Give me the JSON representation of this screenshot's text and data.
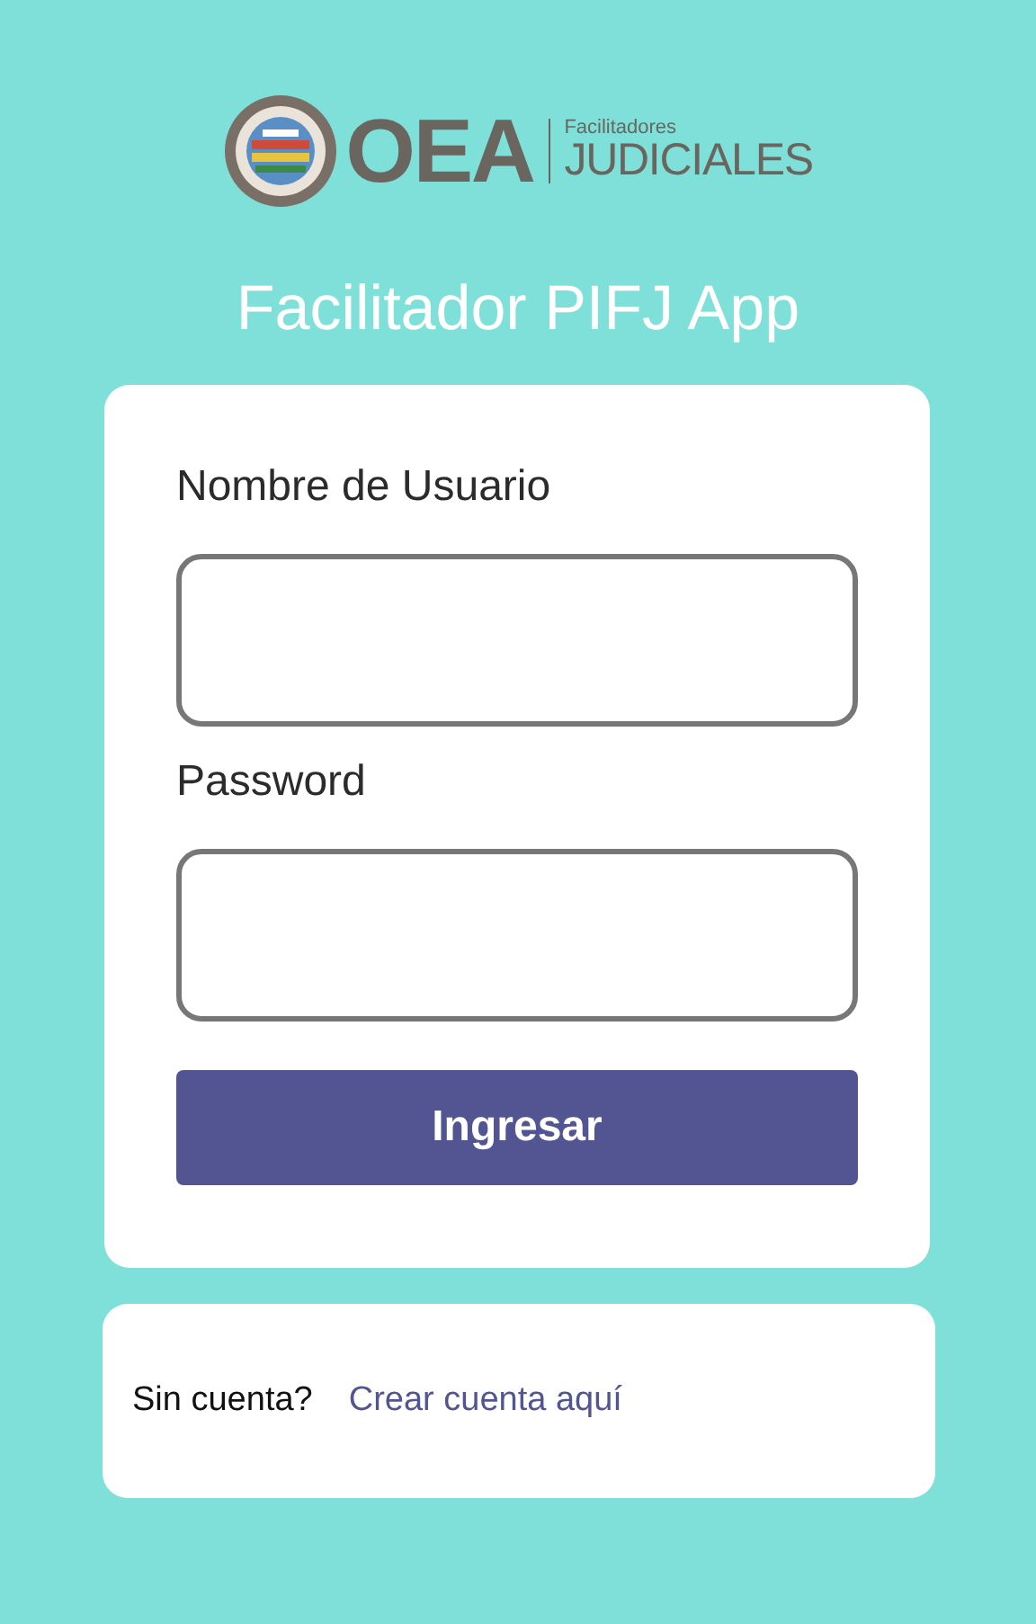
{
  "logo": {
    "mark": "OEA",
    "subtitle": "Facilitadores",
    "name": "JUDICIALES"
  },
  "title": "Facilitador PIFJ App",
  "form": {
    "fields": [
      {
        "label": "Nombre de Usuario"
      },
      {
        "label": "Password"
      }
    ],
    "submit": "Ingresar"
  },
  "signup": {
    "prompt": "Sin cuenta?",
    "link": "Crear cuenta aquí"
  }
}
